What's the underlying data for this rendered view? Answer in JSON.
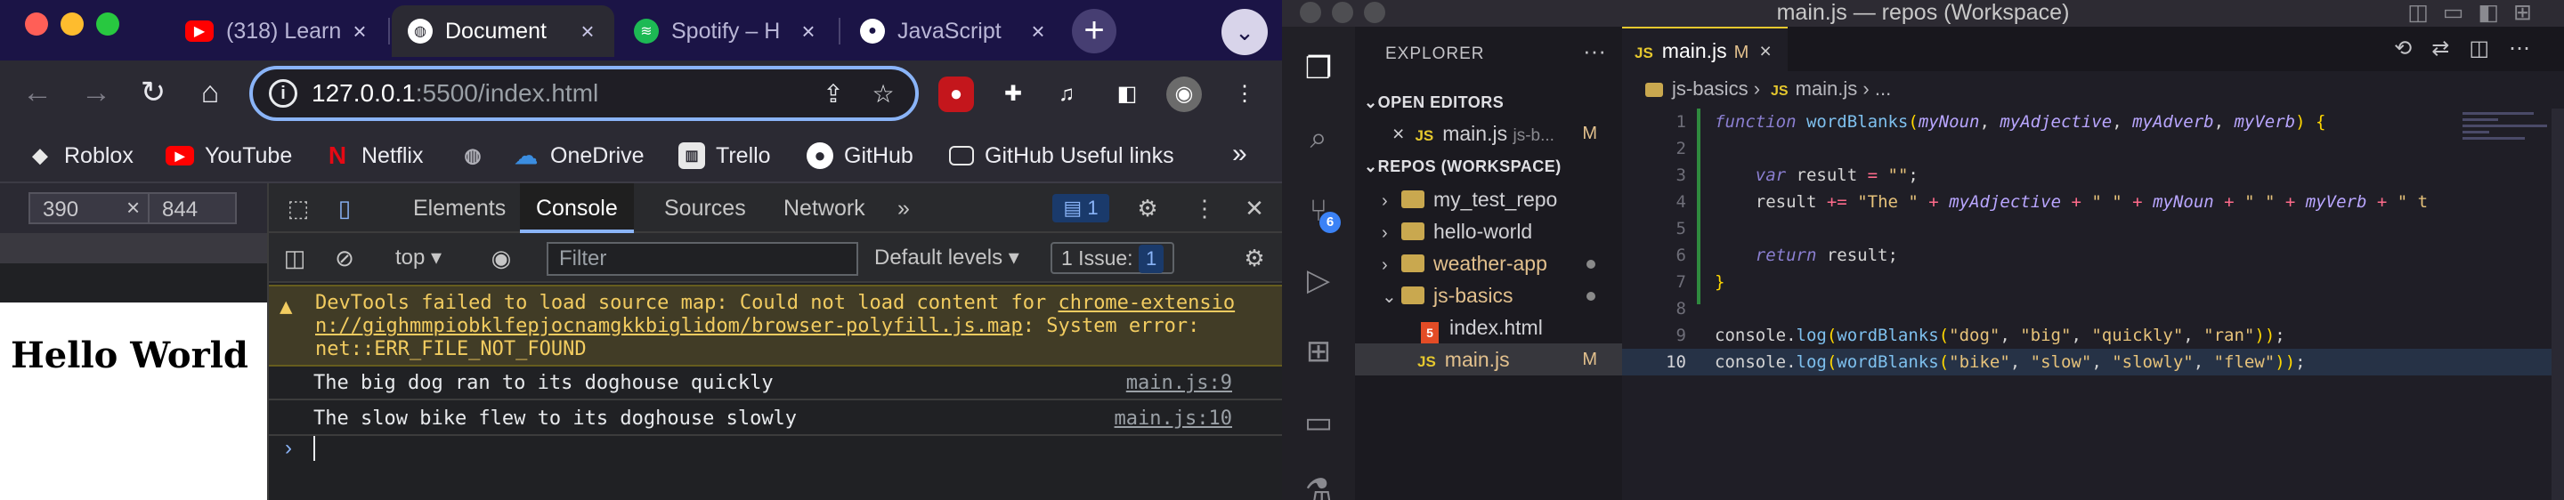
{
  "chrome": {
    "tabs": [
      {
        "title": "(318) Learn",
        "icon": "youtube-icon",
        "color": "#ff0000"
      },
      {
        "title": "Document",
        "icon": "globe-icon",
        "color": "#ffffff"
      },
      {
        "title": "Spotify – H",
        "icon": "spotify-icon",
        "color": "#1db954"
      },
      {
        "title": "JavaScript",
        "icon": "github-icon",
        "color": "#ffffff"
      }
    ],
    "url": {
      "host": "127.0.0.1",
      "path": ":5500/index.html"
    },
    "bookmarks": [
      "Roblox",
      "YouTube",
      "Netflix",
      "OneDrive",
      "Trello",
      "GitHub",
      "GitHub Useful links"
    ],
    "bookmarks_more": "»"
  },
  "device": {
    "width": "390",
    "x": "×",
    "height": "844"
  },
  "page": {
    "heading": "Hello World"
  },
  "devtools": {
    "tabs": [
      "Elements",
      "Console",
      "Sources",
      "Network"
    ],
    "more": "»",
    "issues_badge": "1",
    "context": "top",
    "filter_placeholder": "Filter",
    "levels": "Default levels",
    "issue_label": "1 Issue:",
    "issue_count": "1",
    "warning": {
      "line1_pre": "DevTools failed to load source map: Could not load content for ",
      "line1_link": "chrome-extensio",
      "line2_link": "n://gighmmpiobklfepjocnamgkkbiglidom/browser-polyfill.js.map",
      "line2_post": ": System error:",
      "line3": "net::ERR_FILE_NOT_FOUND"
    },
    "logs": [
      {
        "message": "The big dog ran to its doghouse quickly",
        "source": "main.js:9"
      },
      {
        "message": "The slow bike flew to its doghouse slowly",
        "source": "main.js:10"
      }
    ],
    "prompt": "›"
  },
  "vscode": {
    "title": "main.js — repos (Workspace)",
    "scm_badge": "6",
    "explorer_title": "EXPLORER",
    "open_editors_label": "OPEN EDITORS",
    "open_editor": {
      "close": "×",
      "name": "main.js",
      "path": "js-b...",
      "status": "M"
    },
    "workspace_label": "REPOS (WORKSPACE)",
    "tree": [
      {
        "name": "my_test_repo"
      },
      {
        "name": "hello-world"
      },
      {
        "name": "weather-app"
      },
      {
        "name": "js-basics"
      },
      {
        "name": "index.html"
      },
      {
        "name": "main.js",
        "status": "M"
      }
    ],
    "tab": {
      "name": "main.js",
      "status": "M"
    },
    "breadcrumb": [
      "js-basics",
      "main.js",
      "..."
    ],
    "line_numbers": [
      "1",
      "2",
      "3",
      "4",
      "5",
      "6",
      "7",
      "8",
      "9",
      "10"
    ]
  }
}
